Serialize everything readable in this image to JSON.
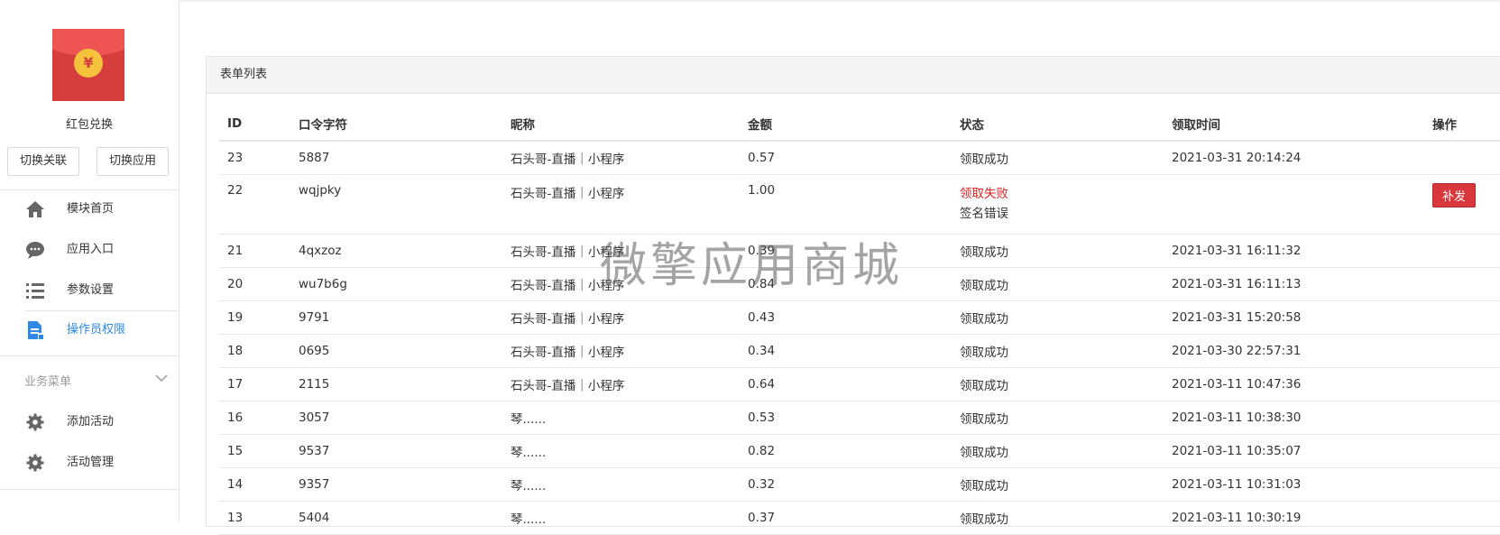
{
  "sidebar": {
    "app_name": "红包兑换",
    "logo_symbol": "¥",
    "buttons": {
      "switch_link": "切换关联",
      "switch_app": "切换应用"
    },
    "menu": [
      {
        "label": "模块首页",
        "icon": "home-icon"
      },
      {
        "label": "应用入口",
        "icon": "chat-bubble-icon"
      },
      {
        "label": "参数设置",
        "icon": "list-settings-icon"
      },
      {
        "label": "操作员权限",
        "icon": "document-icon",
        "active": true
      }
    ],
    "group_title": "业务菜单",
    "group_items": [
      {
        "label": "添加活动",
        "icon": "gear-icon"
      },
      {
        "label": "活动管理",
        "icon": "gear-icon"
      }
    ]
  },
  "panel": {
    "title": "表单列表",
    "columns": [
      "ID",
      "口令字符",
      "昵称",
      "金额",
      "状态",
      "领取时间",
      "操作"
    ],
    "rows": [
      {
        "id": "23",
        "cmd": "5887",
        "nick": "石头哥-直播｜小程序",
        "amount": "0.57",
        "status": "领取成功",
        "time": "2021-03-31 20:14:24"
      },
      {
        "id": "22",
        "cmd": "wqjpky",
        "nick": "石头哥-直播｜小程序",
        "amount": "1.00",
        "status": "领取失败",
        "status_sub": "签名错误",
        "time": "",
        "action": "补发"
      },
      {
        "id": "21",
        "cmd": "4qxzoz",
        "nick": "石头哥-直播｜小程序",
        "amount": "0.39",
        "status": "领取成功",
        "time": "2021-03-31 16:11:32"
      },
      {
        "id": "20",
        "cmd": "wu7b6g",
        "nick": "石头哥-直播｜小程序",
        "amount": "0.84",
        "status": "领取成功",
        "time": "2021-03-31 16:11:13"
      },
      {
        "id": "19",
        "cmd": "9791",
        "nick": "石头哥-直播｜小程序",
        "amount": "0.43",
        "status": "领取成功",
        "time": "2021-03-31 15:20:58"
      },
      {
        "id": "18",
        "cmd": "0695",
        "nick": "石头哥-直播｜小程序",
        "amount": "0.34",
        "status": "领取成功",
        "time": "2021-03-30 22:57:31"
      },
      {
        "id": "17",
        "cmd": "2115",
        "nick": "石头哥-直播｜小程序",
        "amount": "0.64",
        "status": "领取成功",
        "time": "2021-03-11 10:47:36"
      },
      {
        "id": "16",
        "cmd": "3057",
        "nick": "琴......",
        "amount": "0.53",
        "status": "领取成功",
        "time": "2021-03-11 10:38:30"
      },
      {
        "id": "15",
        "cmd": "9537",
        "nick": "琴......",
        "amount": "0.82",
        "status": "领取成功",
        "time": "2021-03-11 10:35:07"
      },
      {
        "id": "14",
        "cmd": "9357",
        "nick": "琴......",
        "amount": "0.32",
        "status": "领取成功",
        "time": "2021-03-11 10:31:03"
      },
      {
        "id": "13",
        "cmd": "5404",
        "nick": "琴......",
        "amount": "0.37",
        "status": "领取成功",
        "time": "2021-03-11 10:30:19"
      }
    ]
  },
  "watermark": "微擎应用商城",
  "colors": {
    "accent": "#2e8ae6",
    "danger": "#e02020",
    "button_red": "#d9373c"
  }
}
